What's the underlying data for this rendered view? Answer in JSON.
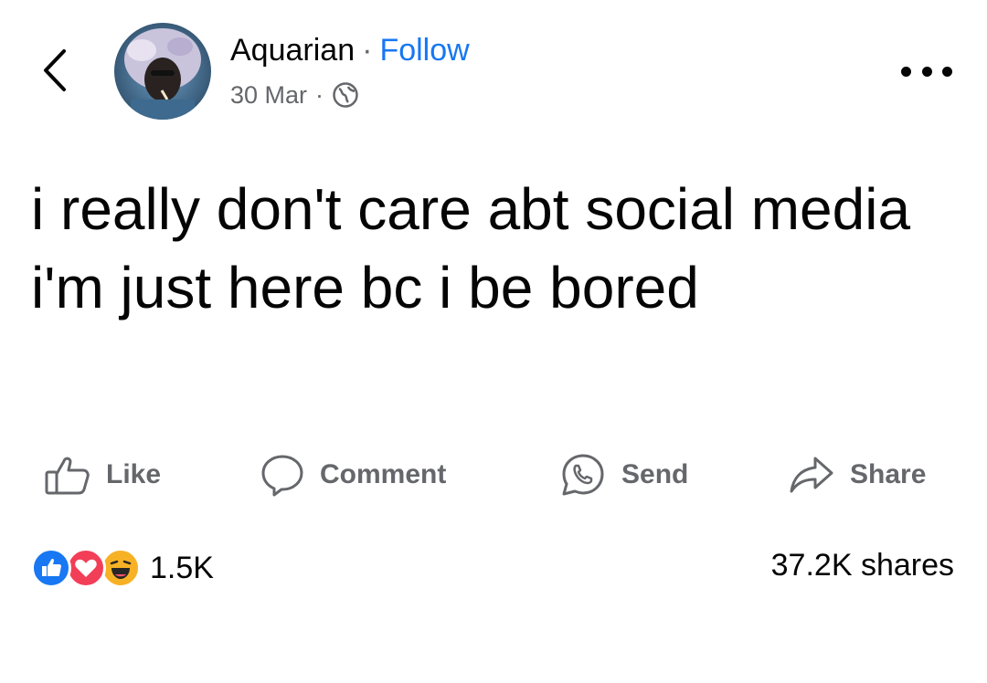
{
  "post": {
    "author": "Aquarian",
    "separator": "·",
    "follow_label": "Follow",
    "date": "30 Mar",
    "meta_dot": "·",
    "privacy_icon": "globe-icon",
    "text": "i really don't care abt social media i'm just here bc i be bored"
  },
  "actions": {
    "like": "Like",
    "comment": "Comment",
    "send": "Send",
    "share": "Share"
  },
  "stats": {
    "reaction_icons": [
      "like-reaction-icon",
      "love-reaction-icon",
      "haha-reaction-icon"
    ],
    "reaction_count": "1.5K",
    "shares": "37.2K shares"
  },
  "colors": {
    "follow": "#1877f2",
    "secondary_text": "#65676b",
    "like_blue": "#1877f2",
    "love_red": "#f33e58",
    "haha_yellow": "#f7b125"
  }
}
